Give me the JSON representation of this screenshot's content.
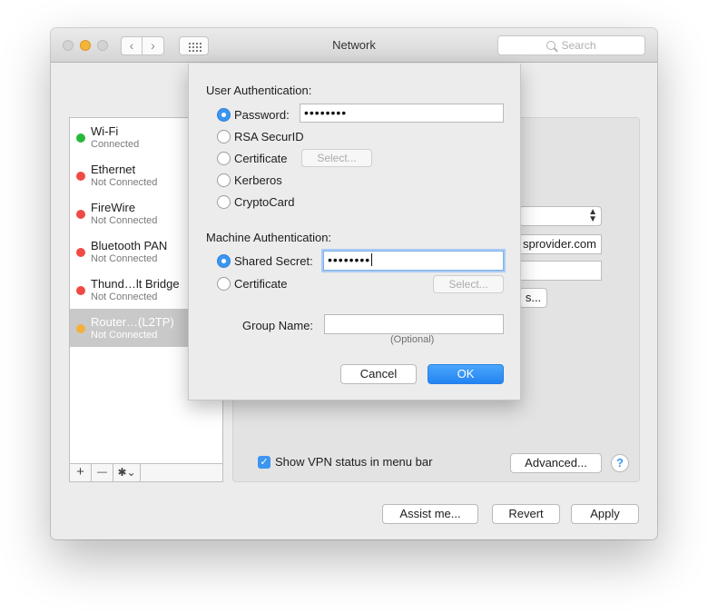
{
  "window": {
    "title": "Network",
    "search_placeholder": "Search",
    "nav": {
      "back": "‹",
      "forward": "›"
    }
  },
  "sidebar": {
    "services": [
      {
        "name": "Wi-Fi",
        "status": "Connected",
        "color": "#28b83a"
      },
      {
        "name": "Ethernet",
        "status": "Not Connected",
        "color": "#ef4a45"
      },
      {
        "name": "FireWire",
        "status": "Not Connected",
        "color": "#ef4a45"
      },
      {
        "name": "Bluetooth PAN",
        "status": "Not Connected",
        "color": "#ef4a45"
      },
      {
        "name": "Thund…lt Bridge",
        "status": "Not Connected",
        "color": "#ef4a45"
      },
      {
        "name": "Router…(L2TP)",
        "status": "Not Connected",
        "color": "#f2b13c",
        "selected": true
      }
    ],
    "toolbar": {
      "add": "+",
      "remove": "—",
      "gear": "✱⌄"
    }
  },
  "panel": {
    "server_address": "sprovider.com",
    "auth_button": "s...",
    "show_vpn_status_label": "Show VPN status in menu bar",
    "show_vpn_status_checked": true,
    "advanced_button": "Advanced...",
    "help": "?"
  },
  "footer": {
    "assist_button": "Assist me...",
    "revert_button": "Revert",
    "apply_button": "Apply"
  },
  "dialog": {
    "user_auth_heading": "User Authentication:",
    "user_auth_options": [
      {
        "label": "Password:",
        "selected": true
      },
      {
        "label": "RSA SecurID",
        "selected": false
      },
      {
        "label": "Certificate",
        "selected": false
      },
      {
        "label": "Kerberos",
        "selected": false
      },
      {
        "label": "CryptoCard",
        "selected": false
      }
    ],
    "password_value": "••••••••",
    "certificate_select": "Select...",
    "machine_auth_heading": "Machine Authentication:",
    "machine_auth_options": [
      {
        "label": "Shared Secret:",
        "selected": true
      },
      {
        "label": "Certificate",
        "selected": false
      }
    ],
    "shared_secret_value": "••••••••",
    "machine_certificate_select": "Select...",
    "group_name_label": "Group Name:",
    "group_name_value": "",
    "group_name_hint": "(Optional)",
    "cancel_button": "Cancel",
    "ok_button": "OK"
  },
  "colors": {
    "accent": "#3b95f1"
  }
}
